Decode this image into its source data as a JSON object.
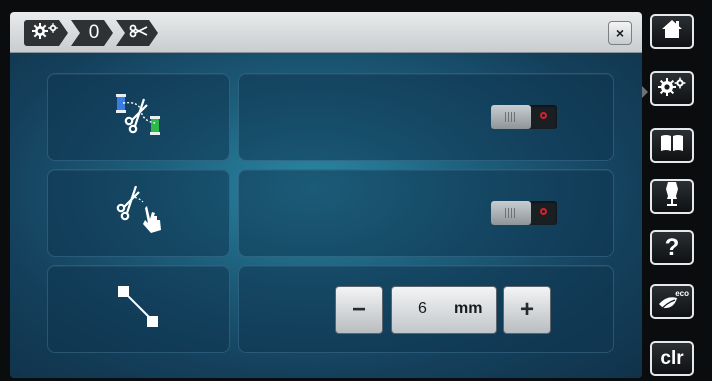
{
  "breadcrumb": {
    "items": [
      {
        "icon": "settings-gears-icon"
      },
      {
        "label": "0"
      },
      {
        "icon": "scissors-icon"
      }
    ]
  },
  "window": {
    "close_label": "×"
  },
  "rows": [
    {
      "icon": "thread-cut-spools-icon",
      "control": {
        "type": "toggle",
        "state": "off"
      }
    },
    {
      "icon": "thread-cut-touch-icon",
      "control": {
        "type": "toggle",
        "state": "off"
      }
    },
    {
      "icon": "stitch-length-jump-icon",
      "control": {
        "type": "stepper",
        "minus_label": "−",
        "value": "6",
        "unit": "mm",
        "plus_label": "+"
      }
    }
  ],
  "sidebar": {
    "buttons": [
      {
        "name": "home-button",
        "icon": "home-icon"
      },
      {
        "name": "settings-button",
        "icon": "gears-icon"
      },
      {
        "name": "tutorial-button",
        "icon": "book-icon"
      },
      {
        "name": "sewing-consultant-button",
        "icon": "dress-form-icon"
      },
      {
        "name": "help-button",
        "label": "?"
      },
      {
        "name": "eco-button",
        "label": "eco"
      },
      {
        "name": "clear-button",
        "label": "clr"
      }
    ]
  },
  "colors": {
    "toggle_off_indicator": "#d8202c",
    "content_bg": "#1d5f7c",
    "spool_blue": "#3a7de0",
    "spool_green": "#2fb84a"
  }
}
